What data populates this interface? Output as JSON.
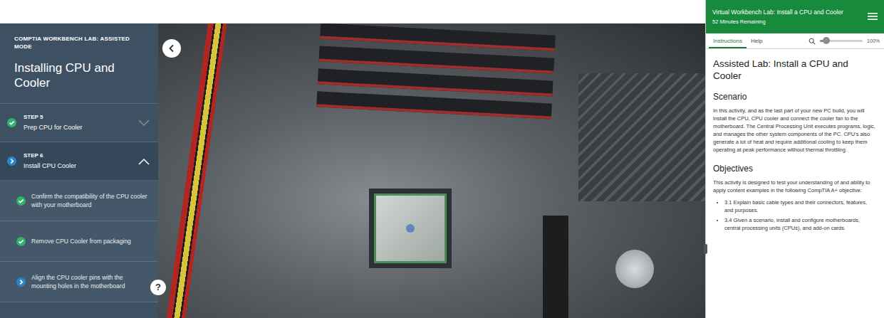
{
  "sidebar": {
    "eyebrow": "COMPTIA WORKBENCH LAB: ASSISTED MODE",
    "title": "Installing CPU and Cooler",
    "steps": [
      {
        "label": "STEP 5",
        "title": "Prep CPU for Cooler",
        "completed": true,
        "current": false,
        "expanded": false,
        "substeps": []
      },
      {
        "label": "STEP 6",
        "title": "Install CPU Cooler",
        "completed": false,
        "current": true,
        "expanded": true,
        "substeps": [
          {
            "text": "Confirm the compatibility of the CPU cooler with your motherboard",
            "completed": true,
            "current": false
          },
          {
            "text": "Remove CPU Cooler from packaging",
            "completed": true,
            "current": false
          },
          {
            "text": "Align the CPU cooler pins with the mounting holes in the motherboard",
            "completed": false,
            "current": true
          }
        ]
      }
    ]
  },
  "scene": {
    "help_button": {
      "label": "?"
    }
  },
  "panel": {
    "title": "Virtual Workbench Lab: Install a CPU and Cooler",
    "timer": "52 Minutes Remaining",
    "tabs": [
      {
        "label": "Instructions",
        "selected": true
      },
      {
        "label": "Help",
        "selected": false
      }
    ],
    "zoom": {
      "level": 0.15,
      "reading": "100%"
    },
    "heading": "Assisted Lab: Install a CPU and Cooler",
    "sections": [
      {
        "heading": "Scenario",
        "paragraphs": [
          "In this activity, and as the last part of your new PC build, you will install the CPU, CPU cooler and connect the cooler fan to the motherboard. The Central Processing Unit executes programs, logic, and manages the other system components of the PC. CPU's also generate a lot of heat and require additional cooling to keep them operating at peak performance without thermal throttling."
        ],
        "bullets": []
      },
      {
        "heading": "Objectives",
        "paragraphs": [
          "This activity is designed to test your understanding of and ability to apply content examples in the following CompTIA A+ objective:"
        ],
        "bullets": [
          "3.1 Explain basic cable types and their connectors, features, and purposes.",
          "3.4 Given a scenario, install and configure motherboards, central processing units (CPUs), and add-on cards."
        ]
      }
    ]
  }
}
